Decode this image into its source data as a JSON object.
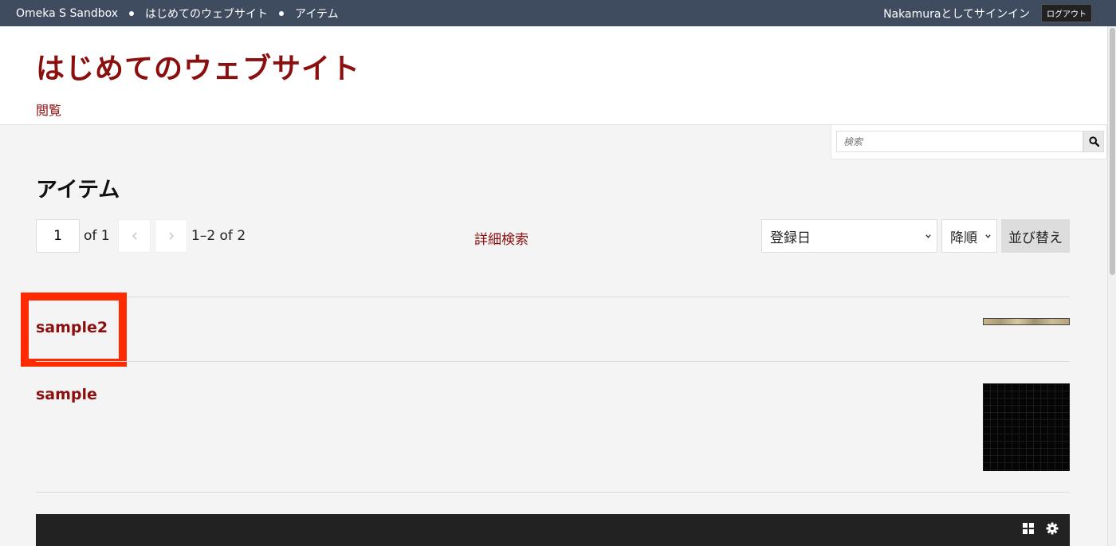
{
  "adminbar": {
    "breadcrumbs": [
      "Omeka S Sandbox",
      "はじめてのウェブサイト",
      "アイテム"
    ],
    "signed_in_text": "Nakamuraとしてサインイン",
    "logout_label": "ログアウト"
  },
  "header": {
    "site_title": "はじめてのウェブサイト",
    "nav_browse": "閲覧"
  },
  "search": {
    "placeholder": "検索"
  },
  "main": {
    "page_title": "アイテム",
    "pagination": {
      "current_page": "1",
      "of_text": "of 1",
      "range_text": "1–2 of 2"
    },
    "advanced_search": "詳細検索",
    "sort": {
      "field_selected": "登録日",
      "order_selected": "降順",
      "button_label": "並び替え"
    },
    "items": [
      {
        "title": "sample2"
      },
      {
        "title": "sample"
      }
    ]
  },
  "colors": {
    "accent": "#8b0f0f",
    "adminbar_bg": "#3f4b5e",
    "highlight": "#ff2a00"
  },
  "icons": [
    "search-icon",
    "chevron-left-icon",
    "chevron-right-icon",
    "chevron-down-icon",
    "grid-icon",
    "gear-icon"
  ]
}
